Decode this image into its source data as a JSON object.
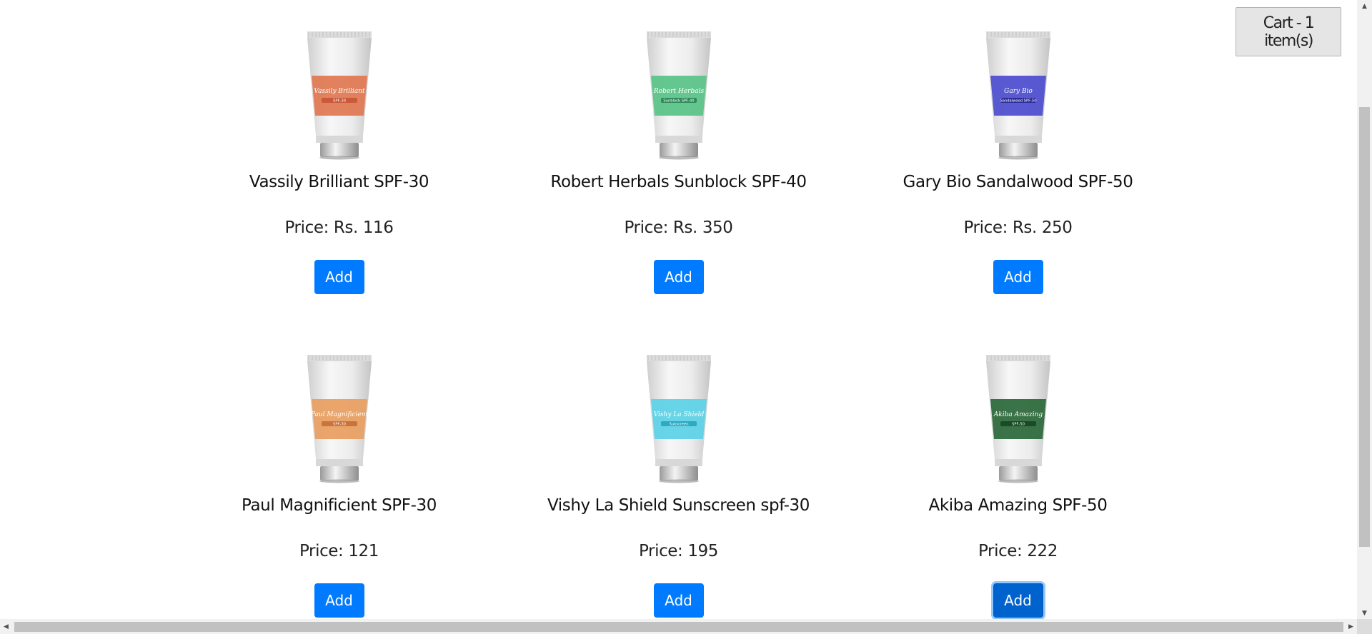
{
  "cart": {
    "label": "Cart - 1 item(s)"
  },
  "products": [
    {
      "name": "Vassily Brilliant SPF-30",
      "price": "Price: Rs. 116",
      "button": "Add",
      "image": {
        "brand": "Vassily Brilliant",
        "sub": "SPF-30",
        "color": "#e07a55",
        "band": "#c9593a"
      }
    },
    {
      "name": "Robert Herbals Sunblock SPF-40",
      "price": "Price: Rs. 350",
      "button": "Add",
      "image": {
        "brand": "Robert Herbals",
        "sub": "Sunblock SPF-40",
        "color": "#5cc48a",
        "band": "#2e8a5a"
      }
    },
    {
      "name": "Gary Bio Sandalwood SPF-50",
      "price": "Price: Rs. 250",
      "button": "Add",
      "image": {
        "brand": "Gary Bio",
        "sub": "Sandalwood SPF-50",
        "color": "#5050d0",
        "band": "#2d2d99"
      }
    },
    {
      "name": "Paul Magnificient SPF-30",
      "price": "Price: 121",
      "button": "Add",
      "image": {
        "brand": "Paul Magnificient",
        "sub": "SPF-30",
        "color": "#e8a063",
        "band": "#c9743a"
      }
    },
    {
      "name": "Vishy La Shield Sunscreen spf-30",
      "price": "Price: 195",
      "button": "Add",
      "image": {
        "brand": "Vishy La Shield",
        "sub": "Sunscreen",
        "color": "#5fd3e6",
        "band": "#2fa8c0"
      }
    },
    {
      "name": "Akiba Amazing SPF-50",
      "price": "Price: 222",
      "button": "Add",
      "image": {
        "brand": "Akiba Amazing",
        "sub": "SPF-50",
        "color": "#2f6b3d",
        "band": "#1a4a26"
      }
    }
  ]
}
